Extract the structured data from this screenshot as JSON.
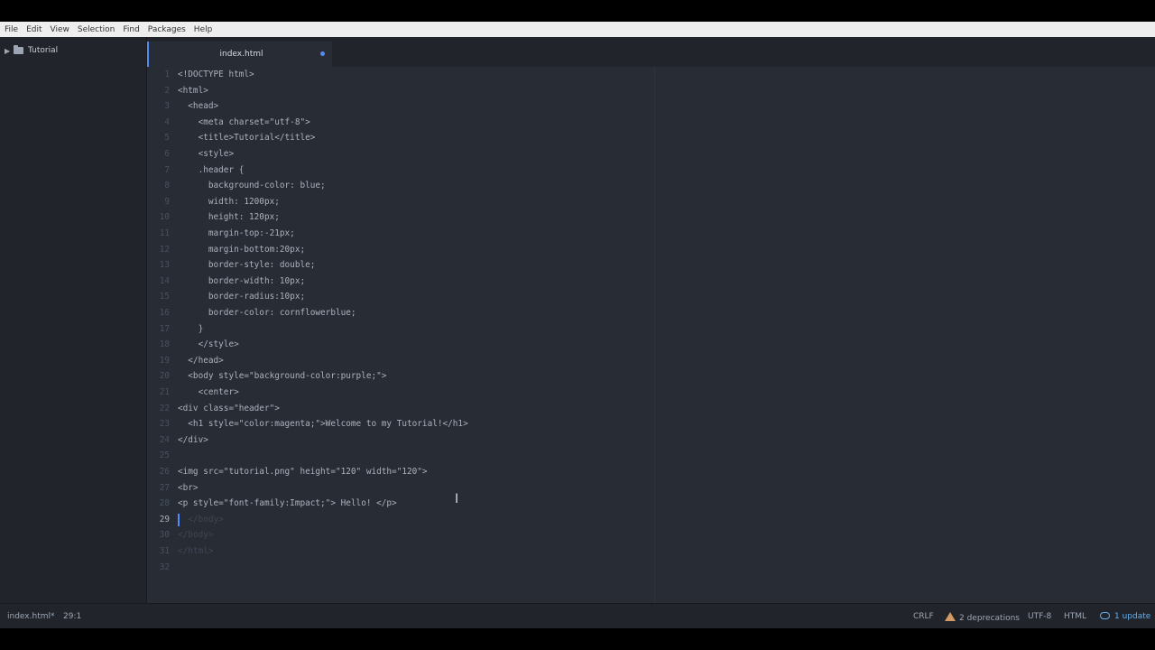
{
  "menu": [
    "File",
    "Edit",
    "View",
    "Selection",
    "Find",
    "Packages",
    "Help"
  ],
  "sidebar": {
    "root_folder": "Tutorial"
  },
  "tab": {
    "title": "index.html",
    "modified": true
  },
  "editor": {
    "active_line": 29,
    "lines": [
      "<!DOCTYPE html>",
      "<html>",
      "  <head>",
      "    <meta charset=\"utf-8\">",
      "    <title>Tutorial</title>",
      "    <style>",
      "    .header {",
      "      background-color: blue;",
      "      width: 1200px;",
      "      height: 120px;",
      "      margin-top:-21px;",
      "      margin-bottom:20px;",
      "      border-style: double;",
      "      border-width: 10px;",
      "      border-radius:10px;",
      "      border-color: cornflowerblue;",
      "    }",
      "    </style>",
      "  </head>",
      "  <body style=\"background-color:purple;\">",
      "    <center>",
      "<div class=\"header\">",
      "  <h1 style=\"color:magenta;\">Welcome to my Tutorial!</h1>",
      "</div>",
      "",
      "<img src=\"tutorial.png\" height=\"120\" width=\"120\">",
      "<br>",
      "<p style=\"font-family:Impact;\"> Hello! </p>",
      "  </body>",
      "</body>",
      "</html>",
      ""
    ]
  },
  "status": {
    "file": "index.html*",
    "position": "29:1",
    "line_ending": "CRLF",
    "deprecations": "2 deprecations",
    "encoding": "UTF-8",
    "grammar": "HTML",
    "update": "1 update"
  },
  "colors": {
    "accent": "#568af2",
    "editor_bg": "#282c34",
    "panel_bg": "#21252b"
  }
}
